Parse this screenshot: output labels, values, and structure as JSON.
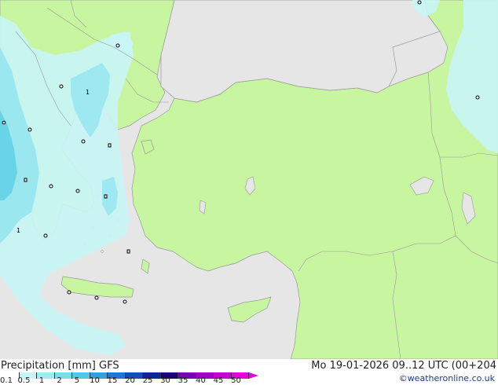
{
  "map": {
    "city_markers": [
      {
        "name": "marker-1"
      },
      {
        "name": "marker-2"
      },
      {
        "name": "marker-3"
      },
      {
        "name": "marker-4"
      },
      {
        "name": "marker-5"
      },
      {
        "name": "marker-6"
      },
      {
        "name": "marker-7"
      },
      {
        "name": "marker-8"
      },
      {
        "name": "marker-9"
      },
      {
        "name": "marker-10"
      },
      {
        "name": "marker-11"
      },
      {
        "name": "marker-12"
      },
      {
        "name": "marker-13"
      },
      {
        "name": "marker-14"
      },
      {
        "name": "marker-15"
      },
      {
        "name": "marker-16"
      },
      {
        "name": "marker-17"
      }
    ],
    "contour_labels": [
      "1",
      "1"
    ],
    "colors": {
      "sea": "#e6e6e6",
      "land": "#c8f5a0",
      "precip_light": "#c8f5f5",
      "precip_mid": "#96e6f0",
      "precip_heavy": "#64d2e6",
      "border": "#999999"
    }
  },
  "footer": {
    "title": "Precipitation [mm] GFS",
    "valid_time": "Mo 19-01-2026 09..12 UTC (00+204",
    "credit": "©weatheronline.co.uk"
  },
  "legend": {
    "ticks": [
      "0.1",
      "0.5",
      "1",
      "2",
      "5",
      "10",
      "15",
      "20",
      "25",
      "30",
      "35",
      "40",
      "45",
      "50"
    ],
    "colors": [
      "#ffffff",
      "#c8f5f5",
      "#a0ebf0",
      "#78dcec",
      "#50c8e6",
      "#32a0dc",
      "#1e78d2",
      "#1450b4",
      "#0a2896",
      "#1e0078",
      "#7800b4",
      "#a000c8",
      "#c800d2",
      "#e600dc"
    ]
  }
}
